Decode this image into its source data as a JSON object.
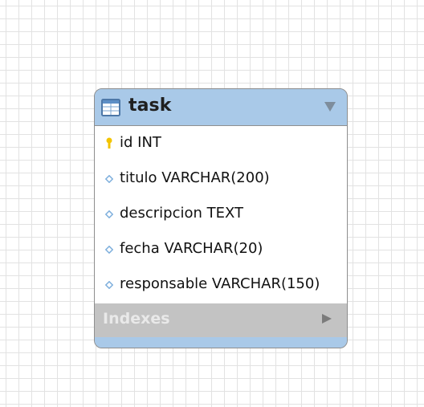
{
  "table": {
    "name": "task",
    "columns": [
      {
        "label": "id INT",
        "icon": "primary-key-icon"
      },
      {
        "label": "titulo VARCHAR(200)",
        "icon": "column-diamond-icon"
      },
      {
        "label": "descripcion TEXT",
        "icon": "column-diamond-icon"
      },
      {
        "label": "fecha VARCHAR(20)",
        "icon": "column-diamond-icon"
      },
      {
        "label": "responsable VARCHAR(150)",
        "icon": "column-diamond-icon"
      }
    ],
    "indexes_label": "Indexes"
  },
  "icons": {
    "header": "table-icon",
    "collapse": "triangle-down-icon",
    "expand": "triangle-right-icon"
  },
  "colors": {
    "header_blue": "#a9c9e8",
    "key_yellow": "#f3c400",
    "diamond_blue": "#7fb0dd",
    "indexes_gray": "#c3c3c3"
  }
}
